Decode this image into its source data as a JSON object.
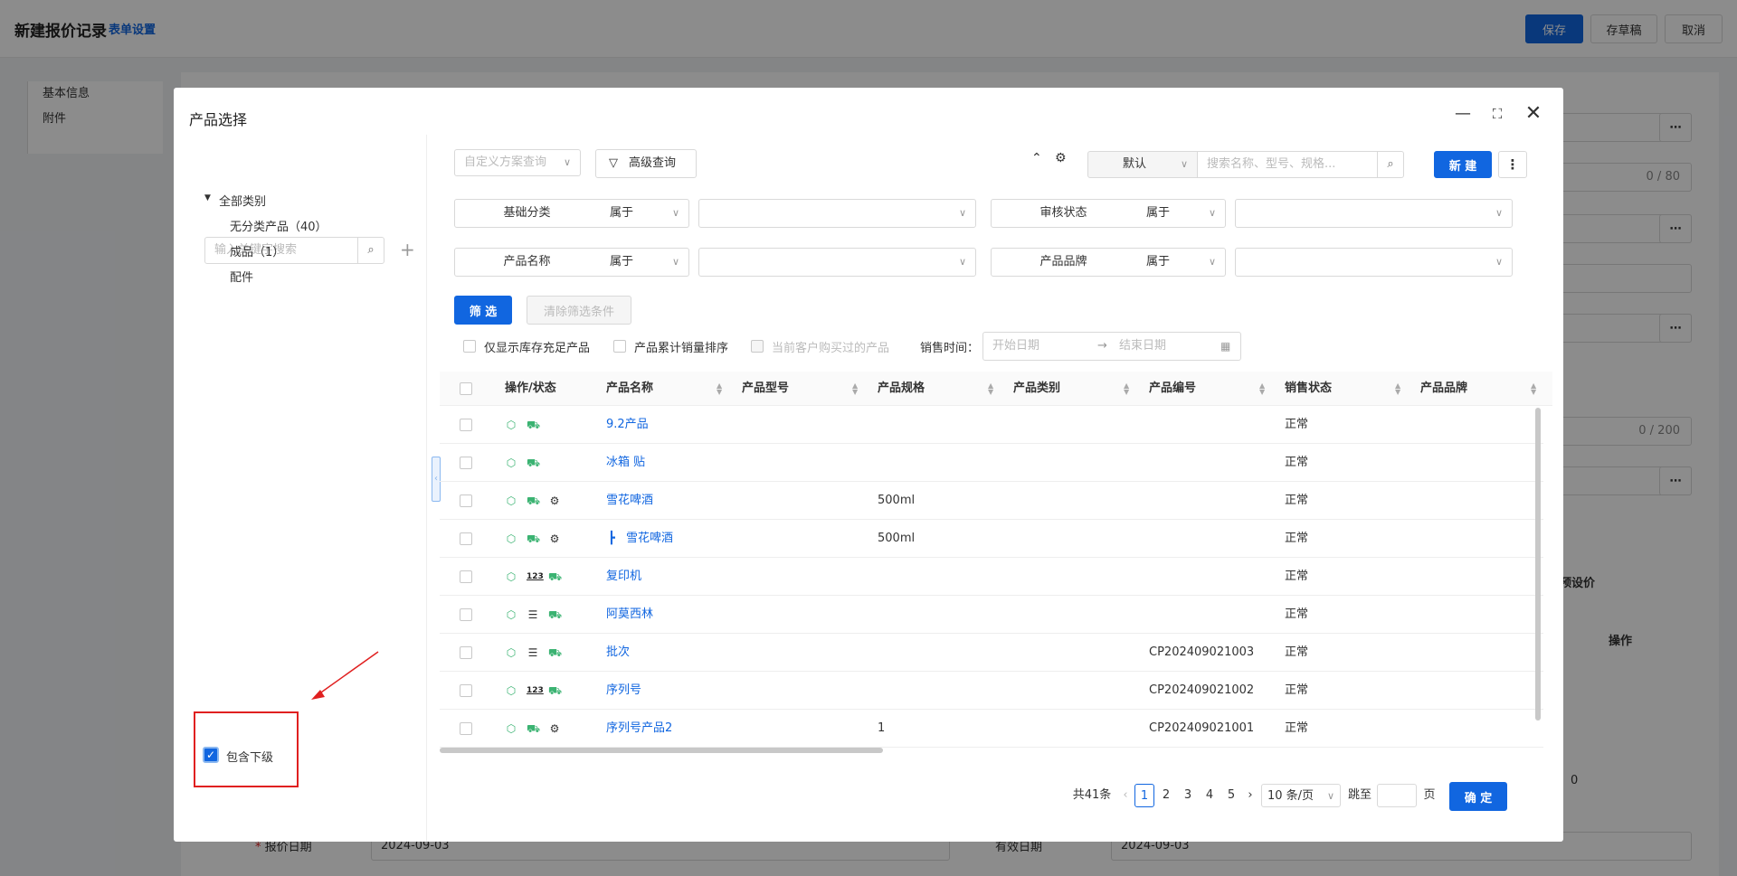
{
  "page": {
    "title": "新建报价记录",
    "form_settings": "表单设置",
    "save": "保存",
    "draft": "存草稿",
    "cancel": "取消",
    "nav": [
      "基本信息",
      "附件"
    ],
    "counter1": "0 / 80",
    "counter2": "0 / 200",
    "quote_date_label": "报价日期",
    "quote_date_value": "2024-09-03",
    "valid_date_label": "有效日期",
    "valid_date_value": "2024-09-03",
    "ops_header": "操作",
    "preset_price_header": "预设价",
    "zero": "0"
  },
  "dialog": {
    "title": "产品选择",
    "search_placeholder": "输入关键字搜索",
    "tree": {
      "root": "全部类别",
      "children": [
        "无分类产品（40）",
        "成品（1）",
        "配件"
      ]
    },
    "include_sub": "包含下级",
    "scheme_placeholder": "自定义方案查询",
    "advanced": "高级查询",
    "sort_default": "默认",
    "search2_placeholder": "搜索名称、型号、规格...",
    "new_btn": "新 建",
    "conditions": [
      {
        "label": "基础分类",
        "op": "属于"
      },
      {
        "label": "审核状态",
        "op": "属于"
      },
      {
        "label": "产品名称",
        "op": "属于"
      },
      {
        "label": "产品品牌",
        "op": "属于"
      }
    ],
    "filter_btn": "筛 选",
    "clear_btn": "清除筛选条件",
    "opt_stock": "仅显示库存充足产品",
    "opt_sales": "产品累计销量排序",
    "opt_bought": "当前客户购买过的产品",
    "sale_time_label": "销售时间：",
    "start_date": "开始日期",
    "end_date": "结束日期",
    "columns": [
      "操作/状态",
      "产品名称",
      "产品型号",
      "产品规格",
      "产品类别",
      "产品编号",
      "销售状态",
      "产品品牌"
    ],
    "rows": [
      {
        "name": "9.2产品",
        "spec": "",
        "code": "",
        "status": "正常",
        "icons": [
          "box",
          "truck"
        ]
      },
      {
        "name": "冰箱 贴",
        "spec": "",
        "code": "",
        "status": "正常",
        "icons": [
          "box",
          "truck"
        ]
      },
      {
        "name": "雪花啤酒",
        "spec": "500ml",
        "code": "",
        "status": "正常",
        "icons": [
          "box",
          "truck",
          "gears"
        ]
      },
      {
        "name": "雪花啤酒",
        "spec": "500ml",
        "code": "",
        "status": "正常",
        "icons": [
          "box",
          "truck",
          "gears"
        ]
      },
      {
        "name": "复印机",
        "spec": "",
        "code": "",
        "status": "正常",
        "icons": [
          "box",
          "serial",
          "truck"
        ]
      },
      {
        "name": "阿莫西林",
        "spec": "",
        "code": "",
        "status": "正常",
        "icons": [
          "box",
          "list",
          "truck"
        ]
      },
      {
        "name": "批次",
        "spec": "",
        "code": "CP202409021003",
        "status": "正常",
        "icons": [
          "box",
          "list",
          "truck"
        ]
      },
      {
        "name": "序列号",
        "spec": "",
        "code": "CP202409021002",
        "status": "正常",
        "icons": [
          "box",
          "serial",
          "truck"
        ]
      },
      {
        "name": "序列号产品2",
        "spec": "1",
        "code": "CP202409021001",
        "status": "正常",
        "icons": [
          "box",
          "truck",
          "gears"
        ]
      }
    ],
    "pagination": {
      "total": "共41条",
      "pages": [
        "1",
        "2",
        "3",
        "4",
        "5"
      ],
      "current": "1",
      "per_page": "10 条/页",
      "jump": "跳至",
      "page_unit": "页",
      "confirm": "确 定"
    }
  },
  "colors": {
    "primary": "#1166e0",
    "green": "#3bb372",
    "red": "#e02020"
  }
}
